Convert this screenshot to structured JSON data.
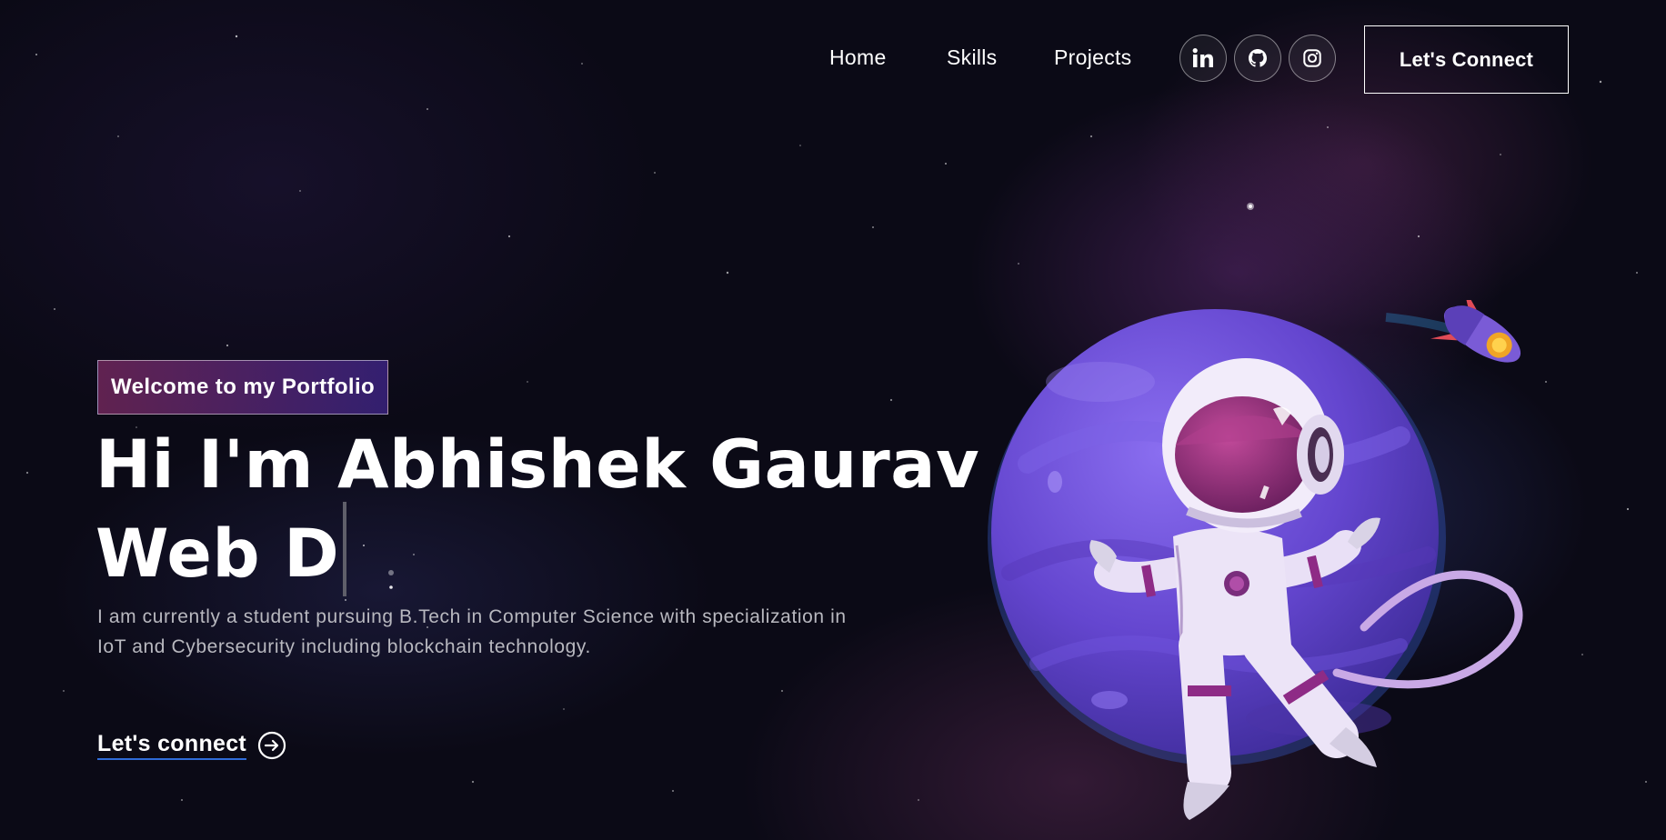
{
  "nav": {
    "links": [
      "Home",
      "Skills",
      "Projects"
    ],
    "social": [
      "linkedin-icon",
      "github-icon",
      "instagram-icon"
    ],
    "connect_label": "Let's Connect"
  },
  "hero": {
    "tagline": "Welcome to my Portfolio",
    "headline_line1": "Hi I'm Abhishek Gaurav",
    "headline_line2": "Web D",
    "intro": "I am currently a student pursuing B.Tech in Computer Science with specialization in IoT and Cybersecurity including blockchain technology.",
    "cta_label": "Let's connect",
    "cta_icon": "arrow-right-circle-icon"
  },
  "colors": {
    "background": "#0b0a16",
    "tagline_gradient_start": "#aa367c",
    "tagline_gradient_end": "#4a2fbd",
    "cta_underline": "#2f6bd8",
    "planet": "#6b4fd8"
  }
}
